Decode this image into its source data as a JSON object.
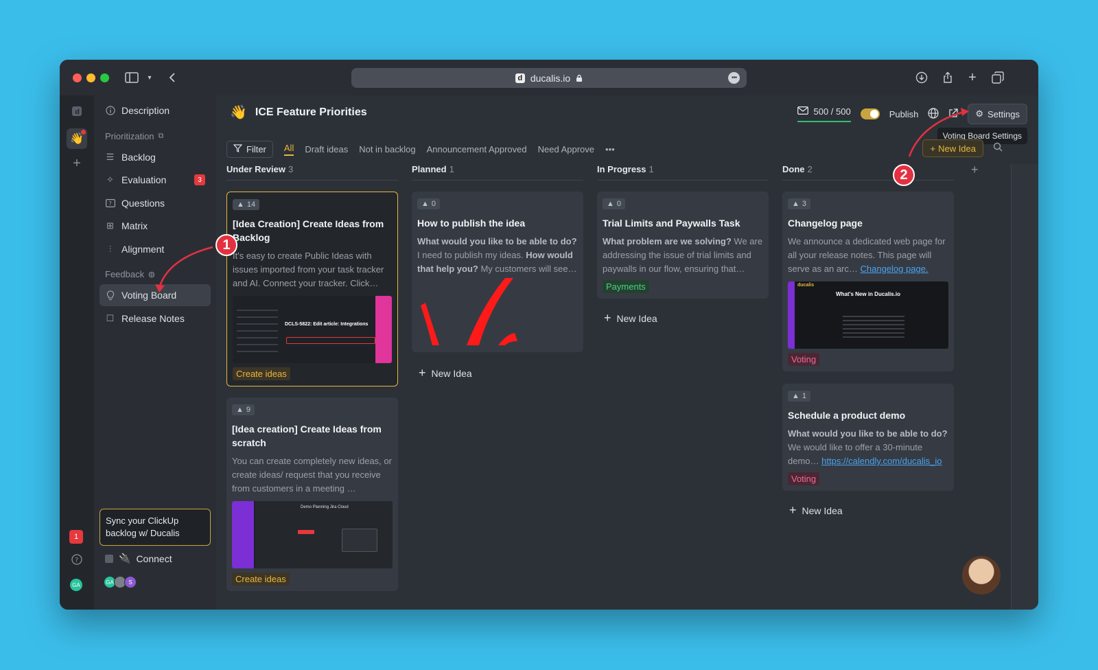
{
  "browser": {
    "url": "ducalis.io",
    "favicon_letter": "d"
  },
  "board": {
    "emoji": "👋",
    "title": "ICE Feature Priorities"
  },
  "header": {
    "credits": "500 / 500",
    "publish_label": "Publish",
    "settings_label": "Settings",
    "tooltip": "Voting Board Settings"
  },
  "sidebar": {
    "description": "Description",
    "prioritization_section": "Prioritization",
    "backlog": "Backlog",
    "evaluation": "Evaluation",
    "evaluation_badge": "3",
    "questions": "Questions",
    "matrix": "Matrix",
    "alignment": "Alignment",
    "feedback_section": "Feedback",
    "voting_board": "Voting Board",
    "release_notes": "Release Notes",
    "sync_text": "Sync your ClickUp backlog w/ Ducalis",
    "connect": "Connect",
    "avatars": [
      "GA",
      "S"
    ]
  },
  "rail": {
    "badge": "1",
    "avatar": "GA"
  },
  "filterbar": {
    "filter": "Filter",
    "tabs": [
      "All",
      "Draft ideas",
      "Not in backlog",
      "Announcement Approved",
      "Need Approve"
    ],
    "more": "•••",
    "new_idea": "New Idea"
  },
  "columns": [
    {
      "title": "Under Review",
      "count": "3"
    },
    {
      "title": "Planned",
      "count": "1"
    },
    {
      "title": "In Progress",
      "count": "1"
    },
    {
      "title": "Done",
      "count": "2"
    }
  ],
  "cards": {
    "c1": {
      "votes": "14",
      "title": "[Idea Creation] Create Ideas from Backlog",
      "desc": "It's easy to create Public Ideas with issues imported from your task tracker and AI. Connect your tracker. Click…",
      "tag": "Create ideas",
      "thumb_title": "DCLS-5822: Edit article: Integrations"
    },
    "c2": {
      "votes": "9",
      "title": "[Idea creation] Create Ideas from scratch",
      "desc": "You can create completely new ideas, or create ideas/ request that you receive from customers in a meeting …",
      "tag": "Create ideas",
      "thumb_title": "Demo Planning Jira Cloud"
    },
    "c3": {
      "votes": "0",
      "title": "How to publish the idea",
      "q1": "What would you like to be able to do?",
      "t1": " I need to publish my ideas. ",
      "q2": "How would that help you?",
      "t2": " My customers will see…"
    },
    "c4": {
      "votes": "0",
      "title": "Trial Limits and Paywalls Task",
      "q1": "What problem are we solving?",
      "t1": " We are addressing the issue of trial limits and paywalls in our flow, ensuring that…",
      "tag": "Payments"
    },
    "c5": {
      "votes": "3",
      "title": "Changelog page",
      "desc": "We announce a dedicated web page for all your release notes. This page will serve as an arc… ",
      "link": "Changelog page.",
      "tag": "Voting",
      "thumb_title": "What's New in Ducalis.io",
      "thumb_brand": "ducalis"
    },
    "c6": {
      "votes": "1",
      "title": "Schedule a product demo",
      "q1": "What would you like to be able to do?",
      "t1": " We would like to offer a 30-minute demo… ",
      "link": "https://calendly.com/ducalis_io",
      "tag": "Voting"
    }
  },
  "new_idea_label": "New Idea",
  "markers": [
    "1",
    "2"
  ],
  "colors": {
    "accent": "#e8b73d",
    "background": "#3bbdea",
    "app_bg": "#2c3138",
    "marker": "#e33140"
  }
}
